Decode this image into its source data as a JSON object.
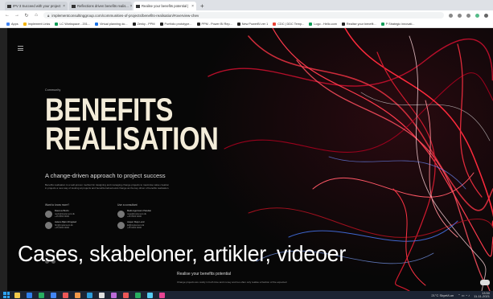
{
  "browser": {
    "tabs": [
      {
        "label": "IPV 3 Succeed with your project",
        "active": false,
        "favicon_color": "#333333"
      },
      {
        "label": "Reflections driven benefits realis...",
        "active": false,
        "favicon_color": "#333333"
      },
      {
        "label": "Realise your benefits potential |",
        "active": true,
        "favicon_color": "#333333"
      }
    ],
    "new_tab_label": "+",
    "url": "implementconsultinggroup.com/communities-of-projects/benefits-realisation/#overview-chev",
    "bookmarks": [
      {
        "label": "Apps",
        "color": "#4285f4"
      },
      {
        "label": "Implement Links",
        "color": "#f4b400"
      },
      {
        "label": "LC Workspace - 201...",
        "color": "#0f9d58"
      },
      {
        "label": "Virtual planning do...",
        "color": "#1a73e8"
      },
      {
        "label": "Zenky - PPM",
        "color": "#222222"
      },
      {
        "label": "Portfolio prototype...",
        "color": "#222222"
      },
      {
        "label": "PPM - Power BI Rep...",
        "color": "#222222"
      },
      {
        "label": "New PowerBI ver 1",
        "color": "#222222"
      },
      {
        "label": "CDC | DDC Temp...",
        "color": "#ea4335"
      },
      {
        "label": "Logo - Hello.com",
        "color": "#0f9d58"
      },
      {
        "label": "Realise your benefit...",
        "color": "#222222"
      },
      {
        "label": "P Strategic innovati...",
        "color": "#0f9d58"
      }
    ]
  },
  "page": {
    "kicker": "Community",
    "hero_line1": "BENEFITS",
    "hero_line2": "REALISATION",
    "tagline": "A change-driven approach to project success",
    "body": "Benefits realisation is a well-proven method for designing and managing change projects to maximise value creation in projects a new way of looking at projects and benefits-behavioural change as the key driver of benefits realisation.",
    "contacts_left_title": "Want to know more?",
    "contacts_right_title": "Use a consultant",
    "contacts_left": [
      {
        "name": "Rasmus Bruhn",
        "email": "rasbr@implement.dk",
        "phone": "+45 0000 0000"
      },
      {
        "name": "Helene Bjørn Ringsted",
        "email": "hbr@implement.dk",
        "phone": "+45 0000 0000"
      }
    ],
    "contacts_right": [
      {
        "name": "Mads Agermann Paludan",
        "email": "map@implement.dk",
        "phone": "+45 0000 0000"
      },
      {
        "name": "Jesper Klejs Lund",
        "email": "jkl@implement.dk",
        "phone": "+45 0000 0000"
      }
    ],
    "share_label": "Share on this link",
    "section2_title": "Realise your benefits potential",
    "section2_text": "Change projects are costly in both time and money and too often only realise a fraction of the expected"
  },
  "overlay_caption": "Cases, skabeloner, artikler, videoer",
  "taskbar": {
    "apps": [
      "#f2c94c",
      "#2f80ed",
      "#27ae60",
      "#4285f4",
      "#eb5757",
      "#f2994a",
      "#2d9cdb",
      "#e0e0e0",
      "#bb6bd9",
      "#eb5757",
      "#27ae60",
      "#56ccf2",
      "#e84393"
    ],
    "tray_text": "21°C Skyet/Lun",
    "time": "13:50",
    "date": "11-11-2021"
  }
}
